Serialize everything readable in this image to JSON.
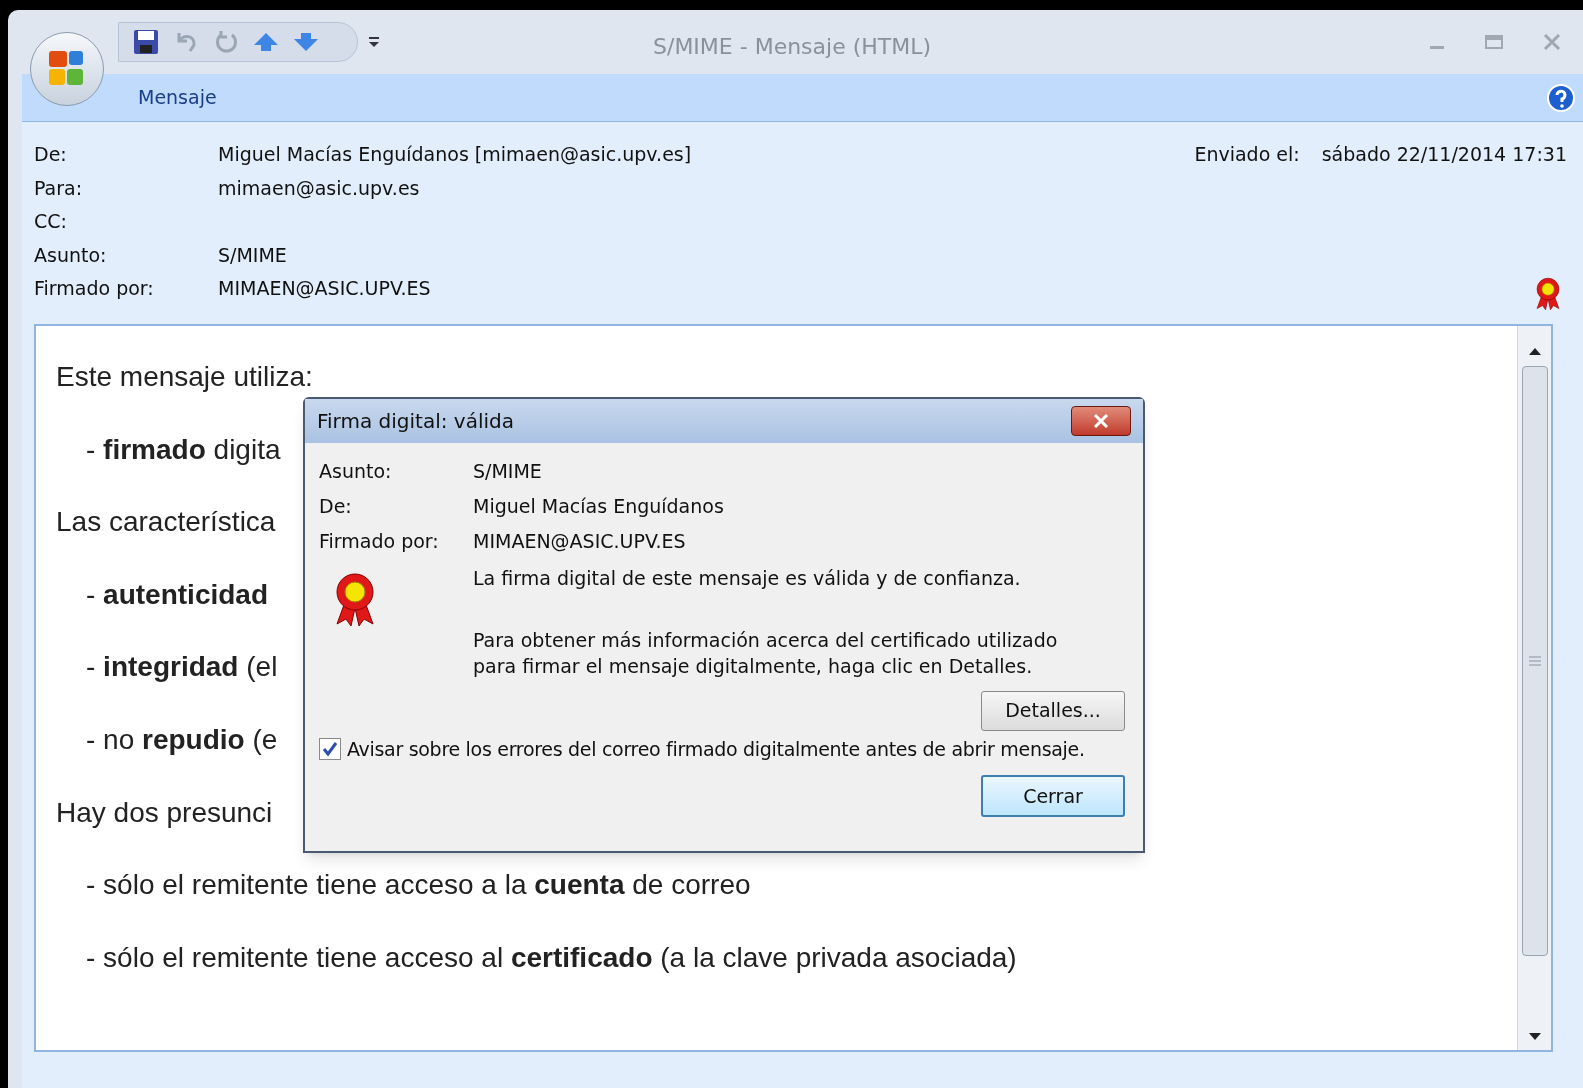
{
  "window": {
    "title": "S/MIME - Mensaje (HTML)"
  },
  "ribbon_tabs": [
    {
      "label": "Mensaje",
      "selected": true
    }
  ],
  "header": {
    "fields": [
      {
        "label": "De:",
        "value": "Miguel Macías Enguídanos [mimaen@asic.upv.es]"
      },
      {
        "label": "Para:",
        "value": "mimaen@asic.upv.es"
      },
      {
        "label": "CC:"
      },
      {
        "label": "Asunto:",
        "value": "S/MIME"
      },
      {
        "label": "Firmado por:",
        "value": "MIMAEN@ASIC.UPV.ES"
      }
    ],
    "sent": {
      "label": "Enviado el:",
      "value": "sábado 22/11/2014 17:31"
    }
  },
  "body": [
    {
      "kind": "para",
      "text": "Este mensaje utiliza:"
    },
    {
      "kind": "bullet",
      "text": "- **firmado** digita"
    },
    {
      "kind": "para",
      "text": "Las característica"
    },
    {
      "kind": "bullet",
      "text": "- **autenticidad**"
    },
    {
      "kind": "bullet",
      "text": "- **integridad** (el"
    },
    {
      "kind": "bullet",
      "text": "- no **repudio** (e"
    },
    {
      "kind": "para",
      "text": "Hay dos presunci"
    },
    {
      "kind": "bullet",
      "text": "- sólo el remitente tiene acceso a la **cuenta** de correo"
    },
    {
      "kind": "bullet",
      "text": "- sólo el remitente tiene acceso al **certificado** (a la clave privada asociada)"
    }
  ],
  "dialog": {
    "title": "Firma digital: válida",
    "fields": [
      {
        "label": "Asunto:",
        "value": "S/MIME"
      },
      {
        "label": "De:",
        "value": "Miguel Macías Enguídanos"
      },
      {
        "label": "Firmado por:",
        "value": "MIMAEN@ASIC.UPV.ES"
      }
    ],
    "status": "La firma digital de este mensaje es válida y de confianza.",
    "info": "Para obtener más información acerca del certificado utilizado para firmar el mensaje digitalmente, haga clic en Detalles.",
    "details_button": "Detalles...",
    "checkbox": {
      "label": "Avisar sobre los errores del correo firmado digitalmente antes de abrir mensaje.",
      "checked": true
    },
    "close_button": "Cerrar"
  }
}
